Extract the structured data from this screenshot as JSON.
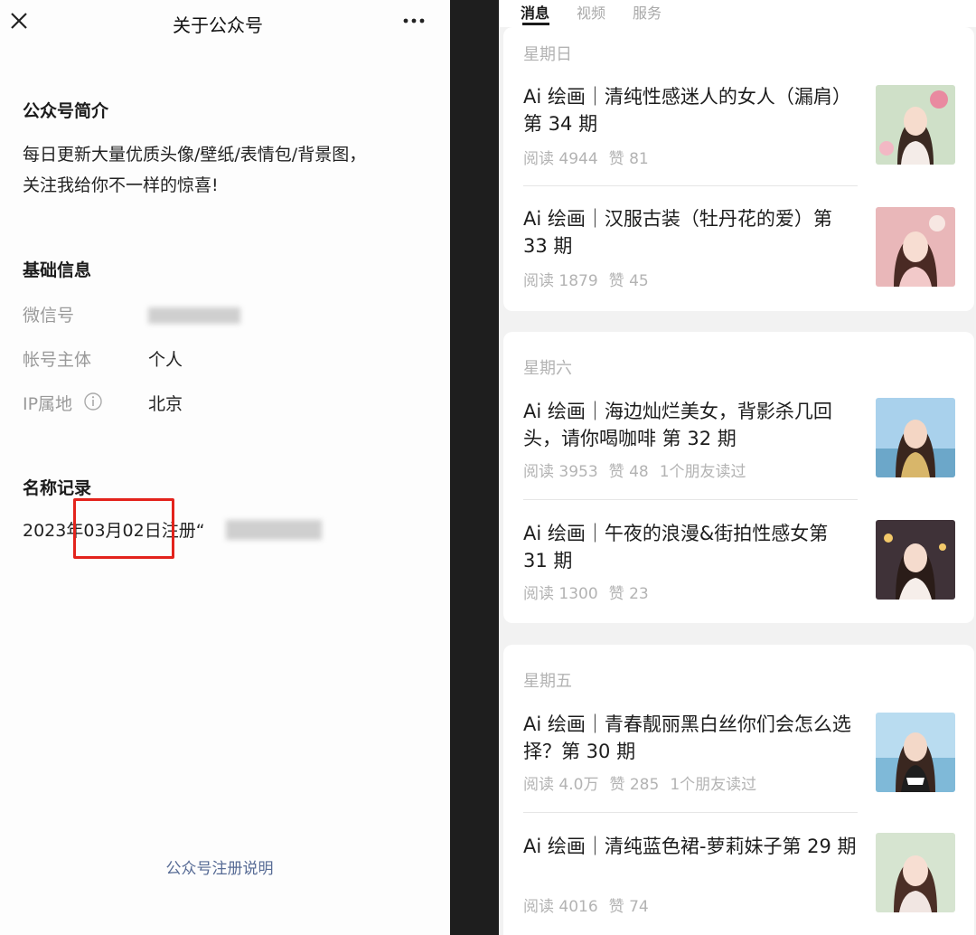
{
  "left": {
    "title": "关于公众号",
    "sections": {
      "intro_title": "公众号简介",
      "intro_text_1": "每日更新大量优质头像/壁纸/表情包/背景图，",
      "intro_text_2": "关注我给你不一样的惊喜!",
      "basic_title": "基础信息",
      "wechat_label": "微信号",
      "account_label": "帐号主体",
      "account_value": "个人",
      "ip_label": "IP属地",
      "ip_value": "北京",
      "history_title": "名称记录",
      "history_text": "2023年03月02日注册“"
    },
    "footer_link": "公众号注册说明",
    "icons": {
      "close": "close-icon",
      "more": "more-icon",
      "info": "info-icon"
    }
  },
  "right": {
    "tabs": [
      "消息",
      "视频",
      "服务"
    ],
    "groups": [
      {
        "day": "星期日",
        "items": [
          {
            "title": "Ai 绘画｜清纯性感迷人的女人（漏肩） 第 34 期",
            "reads": "阅读 4944",
            "likes": "赞 81",
            "friends": ""
          },
          {
            "title": "Ai 绘画｜汉服古装（牡丹花的爱）第 33 期",
            "reads": "阅读 1879",
            "likes": "赞 45",
            "friends": ""
          }
        ]
      },
      {
        "day": "星期六",
        "items": [
          {
            "title": "Ai 绘画｜海边灿烂美女，背影杀几回头，请你喝咖啡 第 32 期",
            "reads": "阅读 3953",
            "likes": "赞 48",
            "friends": "1个朋友读过"
          },
          {
            "title": "Ai 绘画｜午夜的浪漫&街拍性感女第 31 期",
            "reads": "阅读 1300",
            "likes": "赞 23",
            "friends": ""
          }
        ]
      },
      {
        "day": "星期五",
        "items": [
          {
            "title": "Ai 绘画｜青春靓丽黑白丝你们会怎么选择？第 30 期",
            "reads": "阅读 4.0万",
            "likes": "赞 285",
            "friends": "1个朋友读过"
          },
          {
            "title": "Ai 绘画｜清纯蓝色裙-萝莉妹子第 29 期",
            "reads": "阅读 4016",
            "likes": "赞 74",
            "friends": ""
          }
        ]
      }
    ]
  },
  "colors": {
    "link": "#576b95",
    "highlight": "#e3231c",
    "muted": "#b3b3b3"
  }
}
